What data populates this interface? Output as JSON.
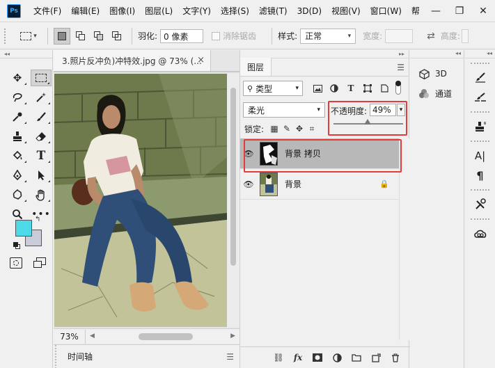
{
  "menubar": {
    "logo": "Ps",
    "items": [
      "文件(F)",
      "编辑(E)",
      "图像(I)",
      "图层(L)",
      "文字(Y)",
      "选择(S)",
      "滤镜(T)",
      "3D(D)",
      "视图(V)",
      "窗口(W)",
      "帮"
    ],
    "window_buttons": [
      "—",
      "❐",
      "✕"
    ]
  },
  "options": {
    "feather_label": "羽化:",
    "feather_value": "0 像素",
    "antialias_label": "消除锯齿",
    "style_label": "样式:",
    "style_value": "正常",
    "width_label": "宽度:",
    "height_label": "高度:"
  },
  "document": {
    "tab_title": "3.照片反冲负)冲特效.jpg @ 73% (...",
    "close": "×",
    "zoom": "73%",
    "timeline_label": "时间轴",
    "photo_colors": {
      "wall": "#6f7a4c",
      "wall_dark": "#4c5636",
      "step": "#8d9a6e",
      "ground": "#c3c39a",
      "skin": "#b98b6a",
      "shirt": "#f0ede0",
      "jeans": "#2f4f78",
      "shoes": "#d4a877",
      "hair": "#1c1812",
      "bag": "#5a2e1c"
    }
  },
  "layers_panel": {
    "tab": "图层",
    "kind_label": "类型",
    "blend_mode": "柔光",
    "opacity_label": "不透明度:",
    "opacity_value": "49%",
    "opacity_percent": 49,
    "lock_label": "锁定:",
    "layers": [
      {
        "name": "背景 拷贝",
        "selected": true,
        "locked": false
      },
      {
        "name": "背景",
        "selected": false,
        "locked": true
      }
    ],
    "accent_color": "#e23b3b"
  },
  "mid_panel": {
    "items": [
      {
        "icon": "cube-icon",
        "label": "3D"
      },
      {
        "icon": "channels-icon",
        "label": "通道"
      }
    ]
  }
}
